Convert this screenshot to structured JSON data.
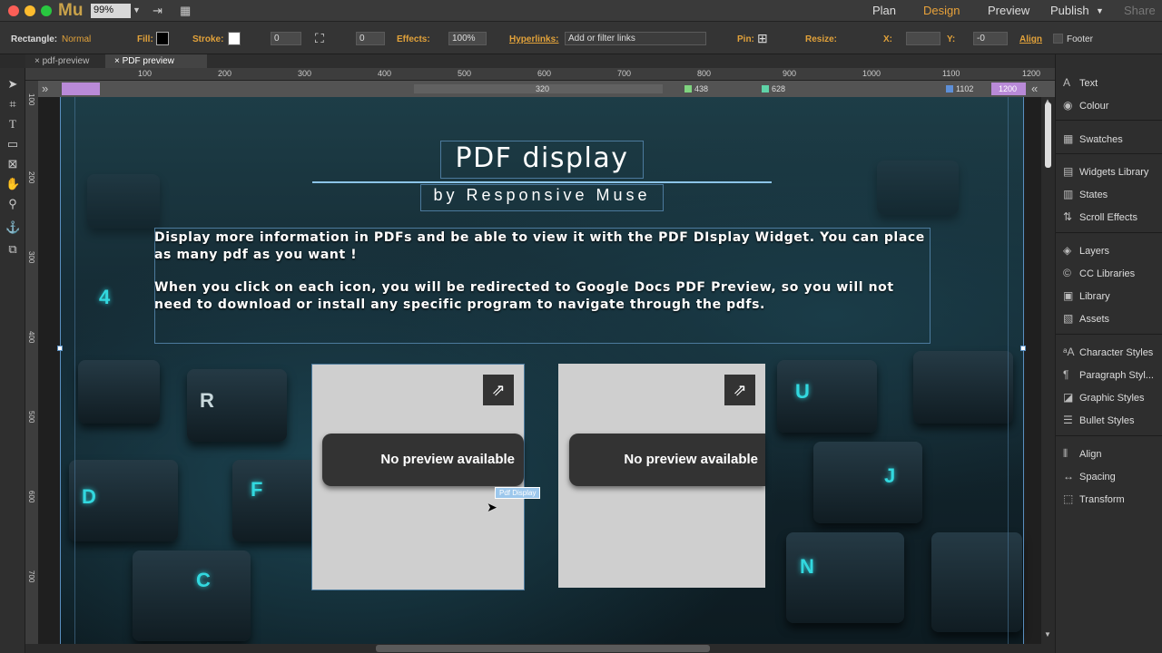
{
  "titlebar": {
    "logo": "Mu",
    "zoom": "99%",
    "nav": [
      "Plan",
      "Design",
      "Preview",
      "Publish",
      "Share"
    ]
  },
  "controls": {
    "selection_label": "Rectangle:",
    "selection_style": "Normal",
    "fill_label": "Fill:",
    "stroke_label": "Stroke:",
    "stroke_width": "0",
    "corner_value": "0",
    "effects_label": "Effects:",
    "effects_value": "100%",
    "hyperlinks_label": "Hyperlinks:",
    "hyperlinks_value": "Add or filter links",
    "pin_label": "Pin:",
    "resize_label": "Resize:",
    "x_label": "X:",
    "y_label": "Y:",
    "y_value": "-0",
    "align_label": "Align",
    "footer_label": "Footer"
  },
  "tabs": [
    {
      "label": "pdf-preview"
    },
    {
      "label": "PDF preview"
    }
  ],
  "ruler": {
    "h": [
      "100",
      "200",
      "300",
      "400",
      "500",
      "600",
      "700",
      "800",
      "900",
      "1000",
      "1100",
      "1200"
    ],
    "v": [
      "100",
      "200",
      "300",
      "400",
      "500",
      "600",
      "700"
    ]
  },
  "breakpoints": {
    "center": "320",
    "a": "438",
    "b": "628",
    "c": "1102",
    "active": "1200"
  },
  "page": {
    "title": "PDF display",
    "subtitle": "by Responsive Muse",
    "para1": "Display more information in PDFs and be able to view it with the PDF DIsplay Widget. You can place as many pdf as you want !",
    "para2": "When you click on each icon, you will be redirected to Google Docs PDF Preview, so you will not need to download or install any specific program to navigate through the pdfs.",
    "no_preview": "No preview available",
    "widget_tag": "Pdf Display"
  },
  "panel": {
    "items": [
      "Text",
      "Colour",
      "Swatches",
      "Widgets Library",
      "States",
      "Scroll Effects",
      "Layers",
      "CC Libraries",
      "Library",
      "Assets",
      "Character Styles",
      "Paragraph Styl...",
      "Graphic Styles",
      "Bullet Styles",
      "Align",
      "Spacing",
      "Transform"
    ]
  },
  "colors": {
    "accent": "#e2a23a",
    "design_active": "#e8a23a",
    "breakpoint": "#b98ad8",
    "glow": "#32d8df"
  }
}
